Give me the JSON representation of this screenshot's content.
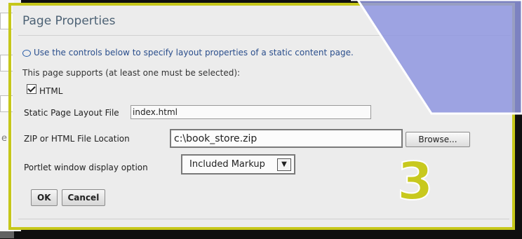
{
  "dialog": {
    "title": "Page Properties",
    "info_text": "Use the controls below to specify layout properties of a static content page.",
    "support_text": "This page supports (at least one must be selected):",
    "html_checkbox": {
      "label": "HTML",
      "checked": true
    },
    "layout_file": {
      "label": "Static Page Layout File",
      "value": "index.html"
    },
    "zip_location": {
      "label": "ZIP or HTML File Location",
      "value": "c:\\book_store.zip",
      "browse_label": "Browse..."
    },
    "portlet_option": {
      "label": "Portlet window display option",
      "selected": "Included Markup"
    },
    "ok_label": "OK",
    "cancel_label": "Cancel"
  },
  "overlay": {
    "step_number": "3",
    "frame_color": "#c6c71a",
    "highlight_color": "#8f97e0"
  },
  "background_window": {
    "partial_text": "e"
  },
  "icons": {
    "info": "info-icon",
    "dropdown": "chevron-down-icon"
  }
}
